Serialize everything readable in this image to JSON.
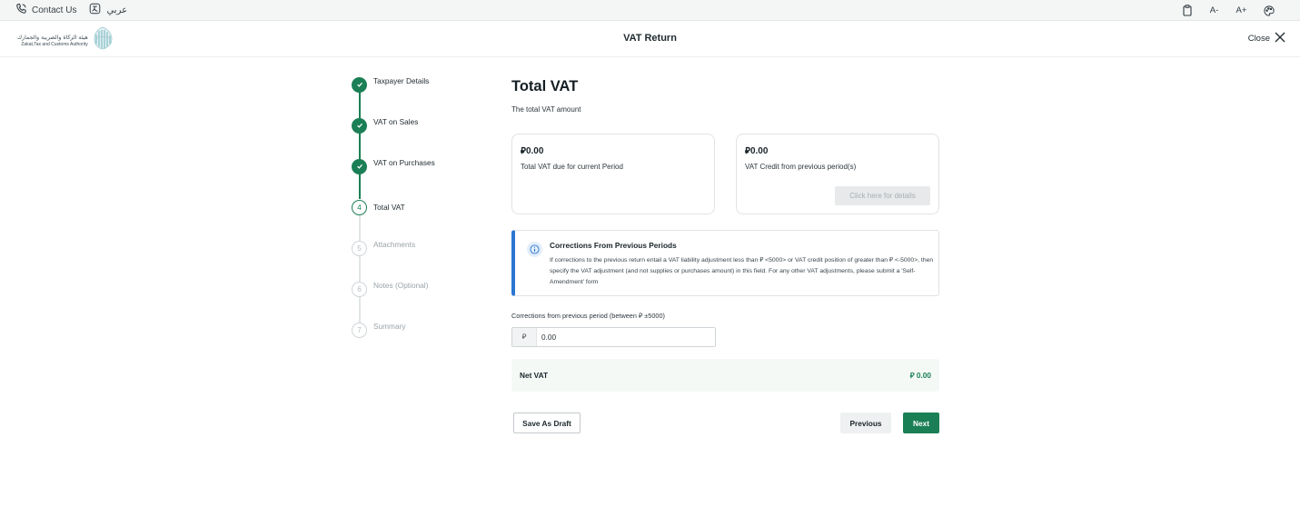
{
  "topbar": {
    "contact_label": "Contact Us",
    "lang_label": "عربي",
    "font_decrease": "A-",
    "font_increase": "A+"
  },
  "header": {
    "logo_ar": "هيئة الزكاة والضريبة والجمارك",
    "logo_en": "Zakat,Tax and Customs Authority",
    "title": "VAT Return",
    "close_label": "Close"
  },
  "stepper": {
    "steps": [
      {
        "number": "1",
        "label": "Taxpayer Details",
        "state": "done"
      },
      {
        "number": "2",
        "label": "VAT on Sales",
        "state": "done"
      },
      {
        "number": "3",
        "label": "VAT on Purchases",
        "state": "done"
      },
      {
        "number": "4",
        "label": "Total VAT",
        "state": "current"
      },
      {
        "number": "5",
        "label": "Attachments",
        "state": "todo"
      },
      {
        "number": "6",
        "label": "Notes (Optional)",
        "state": "todo"
      },
      {
        "number": "7",
        "label": "Summary",
        "state": "todo"
      }
    ]
  },
  "main": {
    "heading": "Total VAT",
    "subtitle": "The total VAT amount",
    "card_due": {
      "amount": "0.00",
      "description": "Total VAT due for current Period"
    },
    "card_credit": {
      "amount": "0.00",
      "description": "VAT Credit from previous period(s)",
      "button": "Click here for details"
    },
    "notice": {
      "title": "Corrections From Previous Periods",
      "body": "If corrections to the previous return entail a VAT liability adjustment less than ⃁ <5000> or VAT credit position of greater than ⃁ <-5000>, then specify the VAT adjustment (and not supplies or purchases amount) in this field. For any other VAT adjustments, please submit a 'Self-Amendment' form"
    },
    "corrections": {
      "label": "Corrections from previous period (between ⃁ ±5000)",
      "currency_prefix": "⃁",
      "value": "0.00"
    },
    "net_vat": {
      "label": "Net VAT",
      "value": "⃁ 0.00"
    },
    "buttons": {
      "save_draft": "Save As Draft",
      "previous": "Previous",
      "next": "Next"
    }
  },
  "colors": {
    "accent_green": "#1b7f55",
    "info_blue": "#2a76d1"
  }
}
